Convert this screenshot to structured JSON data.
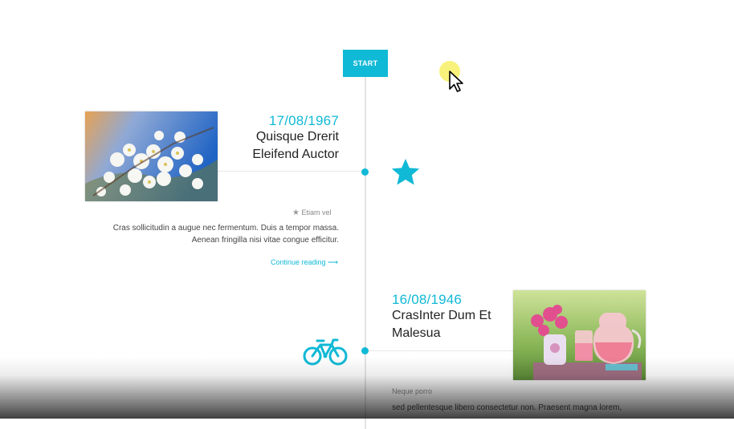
{
  "start": {
    "label": "START"
  },
  "colors": {
    "accent": "#10b9d6"
  },
  "events": [
    {
      "date": "17/08/1967",
      "title_line1": "Quisque Drerit",
      "title_line2": "Eleifend Auctor",
      "icon": "star-icon",
      "meta": "Etiam vel",
      "excerpt_line1": "Cras sollicitudin a augue nec fermentum. Duis a tempor massa.",
      "excerpt_line2": "Aenean fringilla nisi vitae congue efficitur.",
      "read_more": "Continue reading"
    },
    {
      "date": "16/08/1946",
      "title_line1": "CrasInter Dum Et",
      "title_line2": "Malesua",
      "icon": "bicycle-icon",
      "meta": "Neque porro",
      "excerpt_line1": "sed pellentesque libero consectetur non. Praesent magna lorem,"
    }
  ]
}
